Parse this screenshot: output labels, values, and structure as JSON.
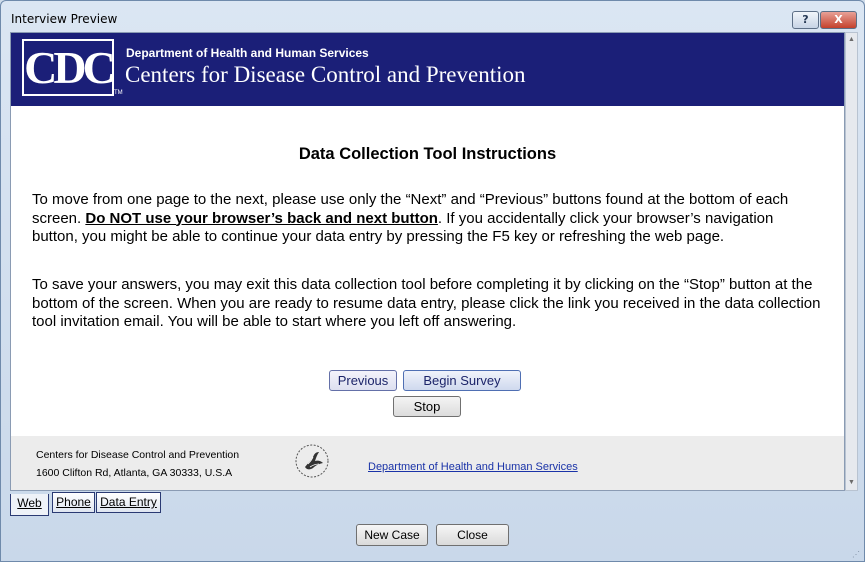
{
  "window": {
    "title": "Interview Preview",
    "help_label": "?",
    "close_label": "X"
  },
  "banner": {
    "logo_text": "CDC",
    "trademark": "TM",
    "department": "Department of Health and Human Services",
    "agency": "Centers for Disease Control and Prevention",
    "background_color": "#1b1f78"
  },
  "main": {
    "heading": "Data Collection Tool Instructions",
    "paragraph1_start": "To move from one page to the next, please use only the “Next” and “Previous” buttons found at the bottom of each screen. ",
    "paragraph1_bold": "Do NOT use your browser’s back and next button",
    "paragraph1_end": ". If you accidentally click your browser’s navigation button, you might be able to continue your data entry by pressing the F5 key or refreshing the web page.",
    "paragraph2": "To save your answers, you may exit this data collection tool before completing it by clicking on the “Stop” button at the bottom of the screen. When you are ready to resume data entry, please click the link you received in the data collection tool invitation email. You will be able to start where you left off answering."
  },
  "buttons": {
    "previous": "Previous",
    "begin": "Begin Survey",
    "stop": "Stop"
  },
  "footer": {
    "org": "Centers for Disease Control and Prevention",
    "address": "1600 Clifton Rd, Atlanta, GA 30333, U.S.A",
    "hhs_link": "Department of Health and Human Services"
  },
  "tabs": [
    {
      "label": "Web"
    },
    {
      "label": "Phone"
    },
    {
      "label": "Data Entry"
    }
  ],
  "dialog_buttons": {
    "new_case": "New Case",
    "close": "Close"
  }
}
